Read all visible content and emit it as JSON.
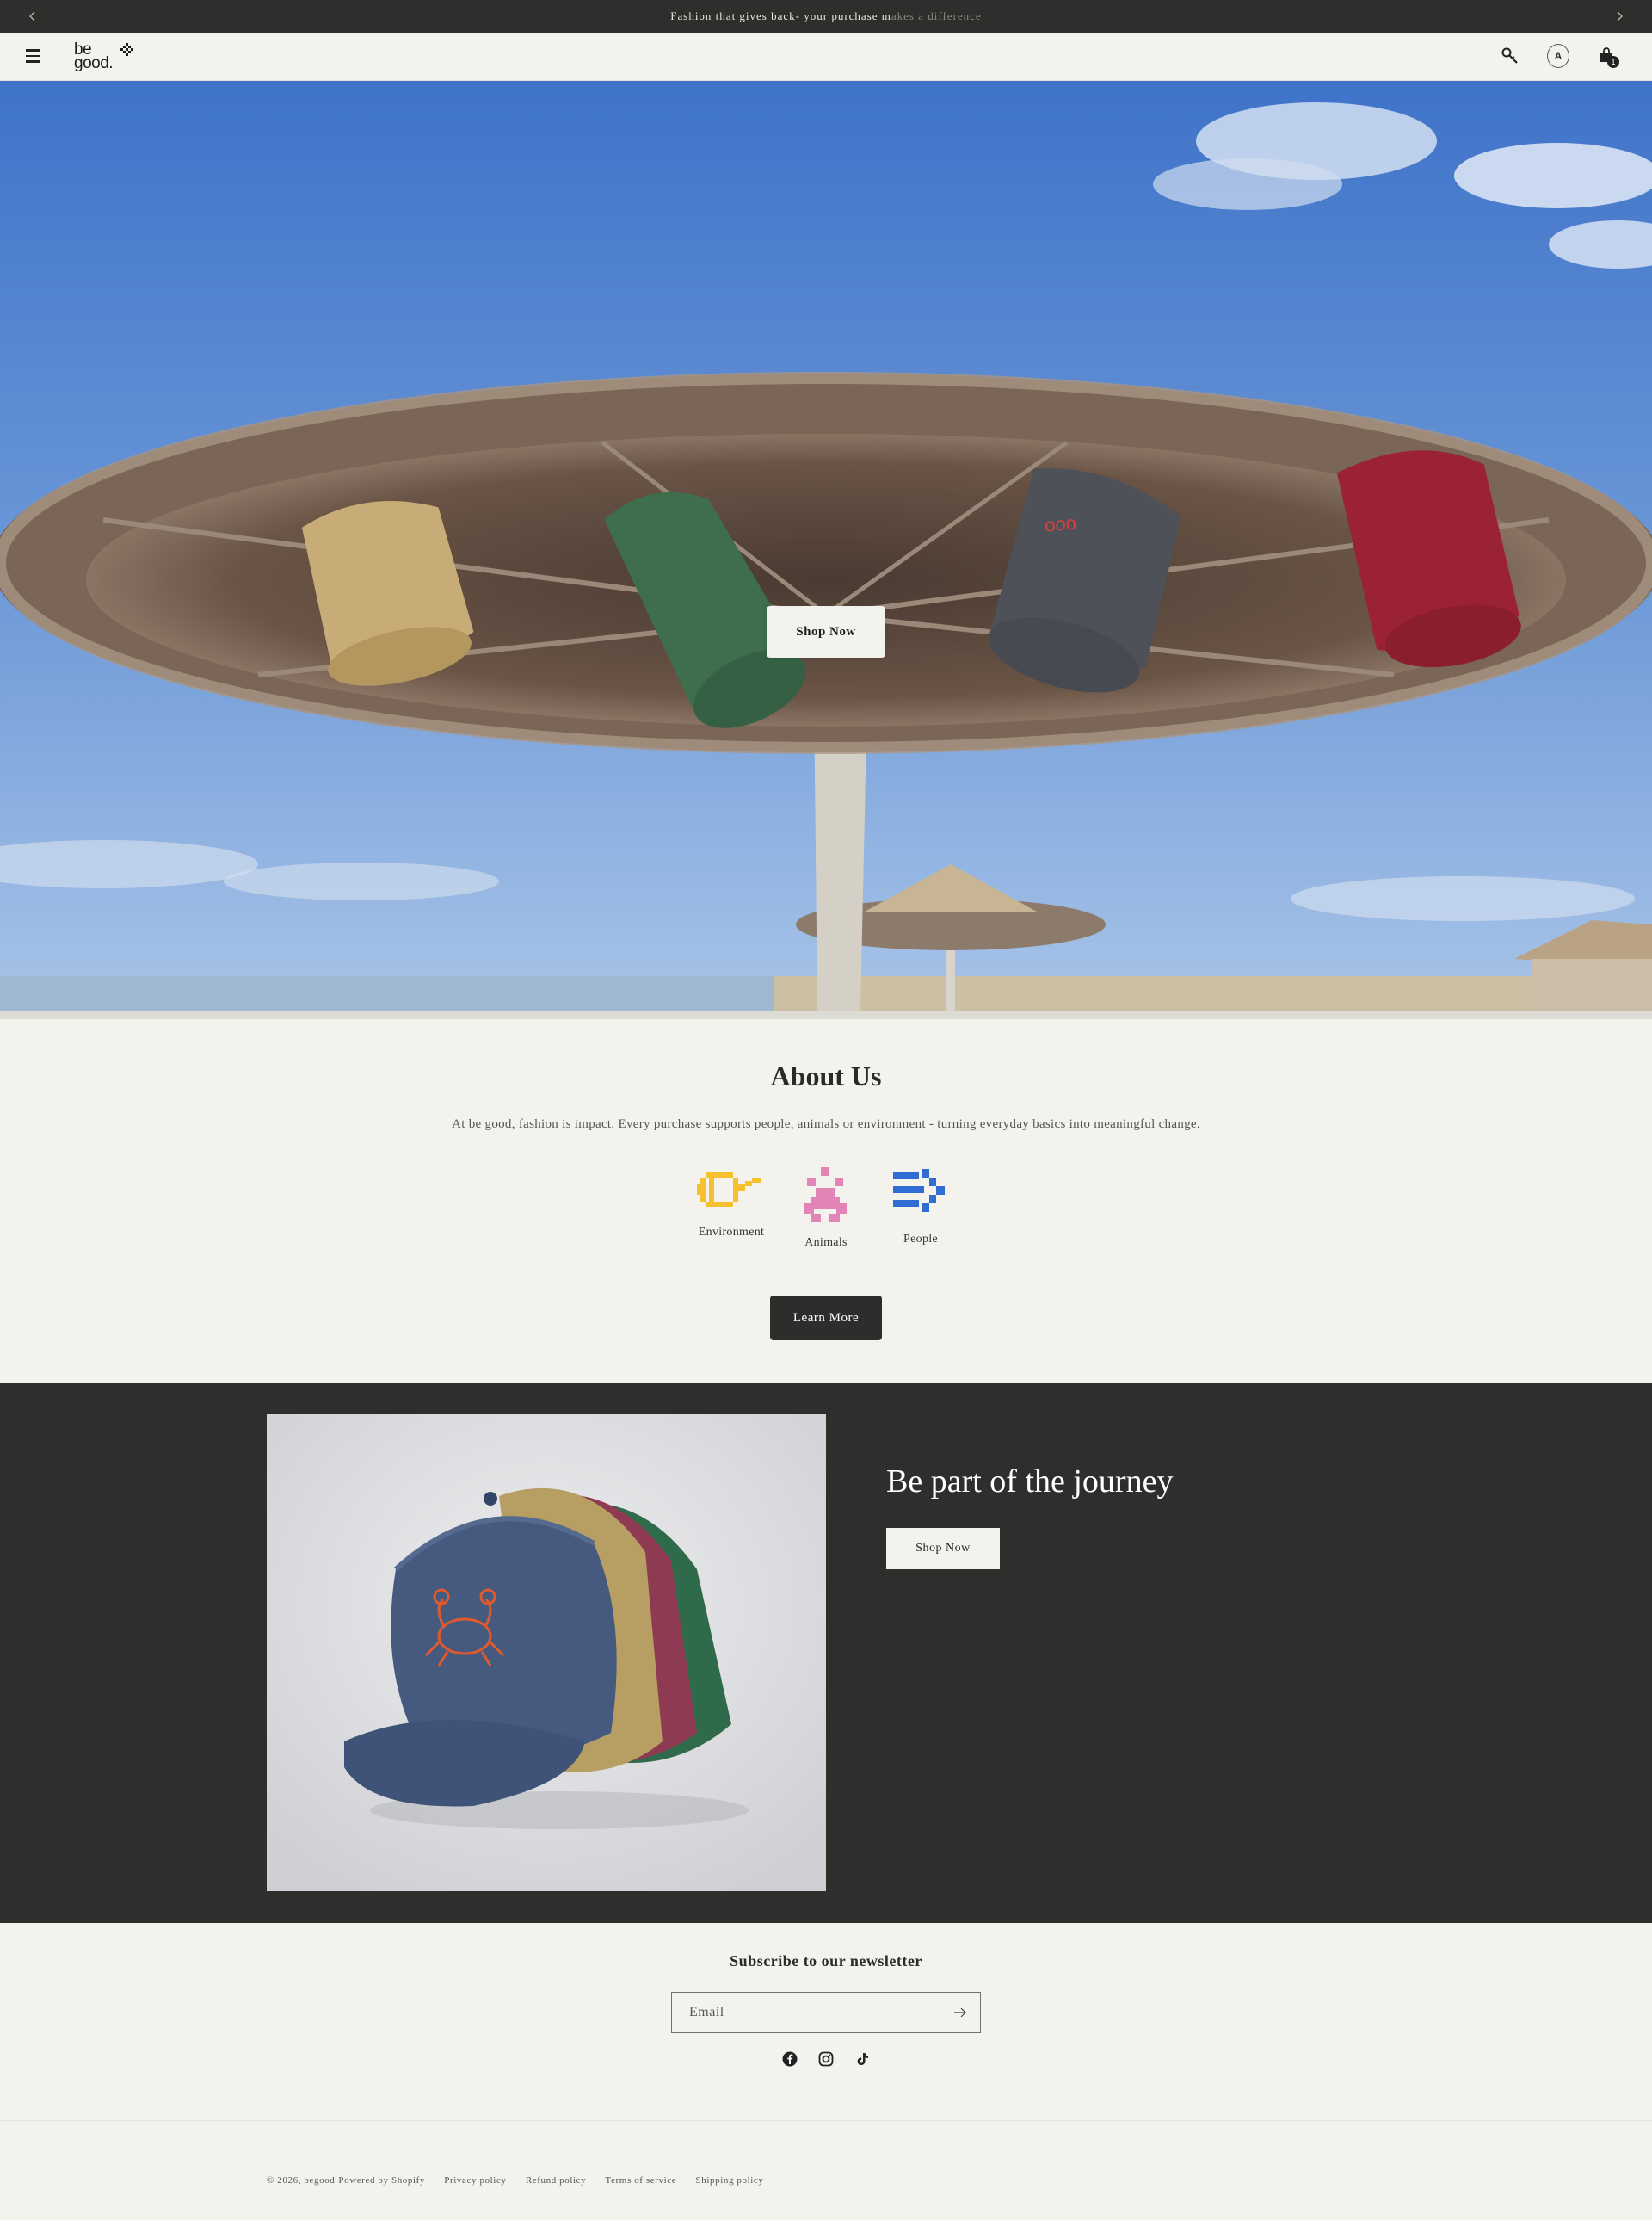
{
  "announcement": {
    "text_main": "Fashion that gives back- your purchase m",
    "text_fade": "akes a difference",
    "prev_icon": "chevron-left-icon",
    "next_icon": "chevron-right-icon"
  },
  "header": {
    "logo_line1": "be",
    "logo_line2": "good.",
    "account_initial": "A",
    "cart_count": "1",
    "icons": [
      "menu-icon",
      "search-icon",
      "account-icon",
      "cart-icon"
    ]
  },
  "hero": {
    "button_label": "Shop Now"
  },
  "about": {
    "title": "About Us",
    "text": "At be good, fashion is impact. Every purchase supports people, animals or environment - turning everyday basics into meaningful change.",
    "values": [
      {
        "label": "Environment",
        "icon": "environment-icon",
        "color": "#f5c12e"
      },
      {
        "label": "Animals",
        "icon": "animals-icon",
        "color": "#e284b6"
      },
      {
        "label": "People",
        "icon": "people-icon",
        "color": "#2f6dd4"
      }
    ],
    "button_label": "Learn More"
  },
  "journey": {
    "title": "Be part of the journey",
    "button_label": "Shop Now"
  },
  "newsletter": {
    "title": "Subscribe to our newsletter",
    "email_placeholder": "Email",
    "socials": [
      "facebook-icon",
      "instagram-icon",
      "tiktok-icon"
    ]
  },
  "footer": {
    "copyright": "© 2026, begood",
    "powered": "Powered by Shopify",
    "links": [
      "Privacy policy",
      "Refund policy",
      "Terms of service",
      "Shipping policy"
    ]
  },
  "colors": {
    "background": "#f3f2ec",
    "dark": "#2e2e2c",
    "environment": "#f5c12e",
    "animals": "#e284b6",
    "people": "#2f6dd4"
  }
}
